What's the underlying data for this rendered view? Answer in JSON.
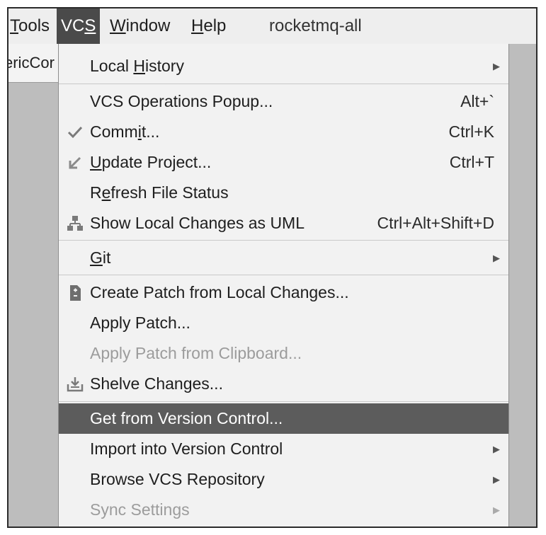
{
  "menubar": {
    "items": [
      {
        "label": "Tools",
        "mnemonic": "T",
        "active": false
      },
      {
        "label": "VCS",
        "mnemonic": "S",
        "active": true
      },
      {
        "label": "Window",
        "mnemonic": "W",
        "active": false
      },
      {
        "label": "Help",
        "mnemonic": "H",
        "active": false
      }
    ],
    "project_name": "rocketmq-all"
  },
  "editor_tab": {
    "label": "ericCor"
  },
  "vcs_menu": {
    "items": [
      {
        "label": "Local History",
        "submenu": true
      },
      {
        "label": "VCS Operations Popup...",
        "shortcut": "Alt+`"
      },
      {
        "label": "Commit...",
        "shortcut": "Ctrl+K",
        "icon": "check-icon"
      },
      {
        "label": "Update Project...",
        "shortcut": "Ctrl+T",
        "icon": "update-arrow-icon"
      },
      {
        "label": "Refresh File Status"
      },
      {
        "label": "Show Local Changes as UML",
        "shortcut": "Ctrl+Alt+Shift+D",
        "icon": "uml-diagram-icon"
      },
      {
        "label": "Git",
        "submenu": true
      },
      {
        "label": "Create Patch from Local Changes...",
        "icon": "patch-icon"
      },
      {
        "label": "Apply Patch..."
      },
      {
        "label": "Apply Patch from Clipboard...",
        "disabled": true
      },
      {
        "label": "Shelve Changes...",
        "icon": "shelve-icon"
      },
      {
        "label": "Get from Version Control...",
        "selected": true
      },
      {
        "label": "Import into Version Control",
        "submenu": true
      },
      {
        "label": "Browse VCS Repository",
        "submenu": true
      },
      {
        "label": "Sync Settings",
        "submenu": true,
        "disabled": true
      }
    ]
  },
  "colors": {
    "menu_background": "#f2f2f2",
    "selection": "#5c5c5c",
    "disabled_text": "#9c9c9c",
    "menubar_active": "#4a4a4a"
  }
}
